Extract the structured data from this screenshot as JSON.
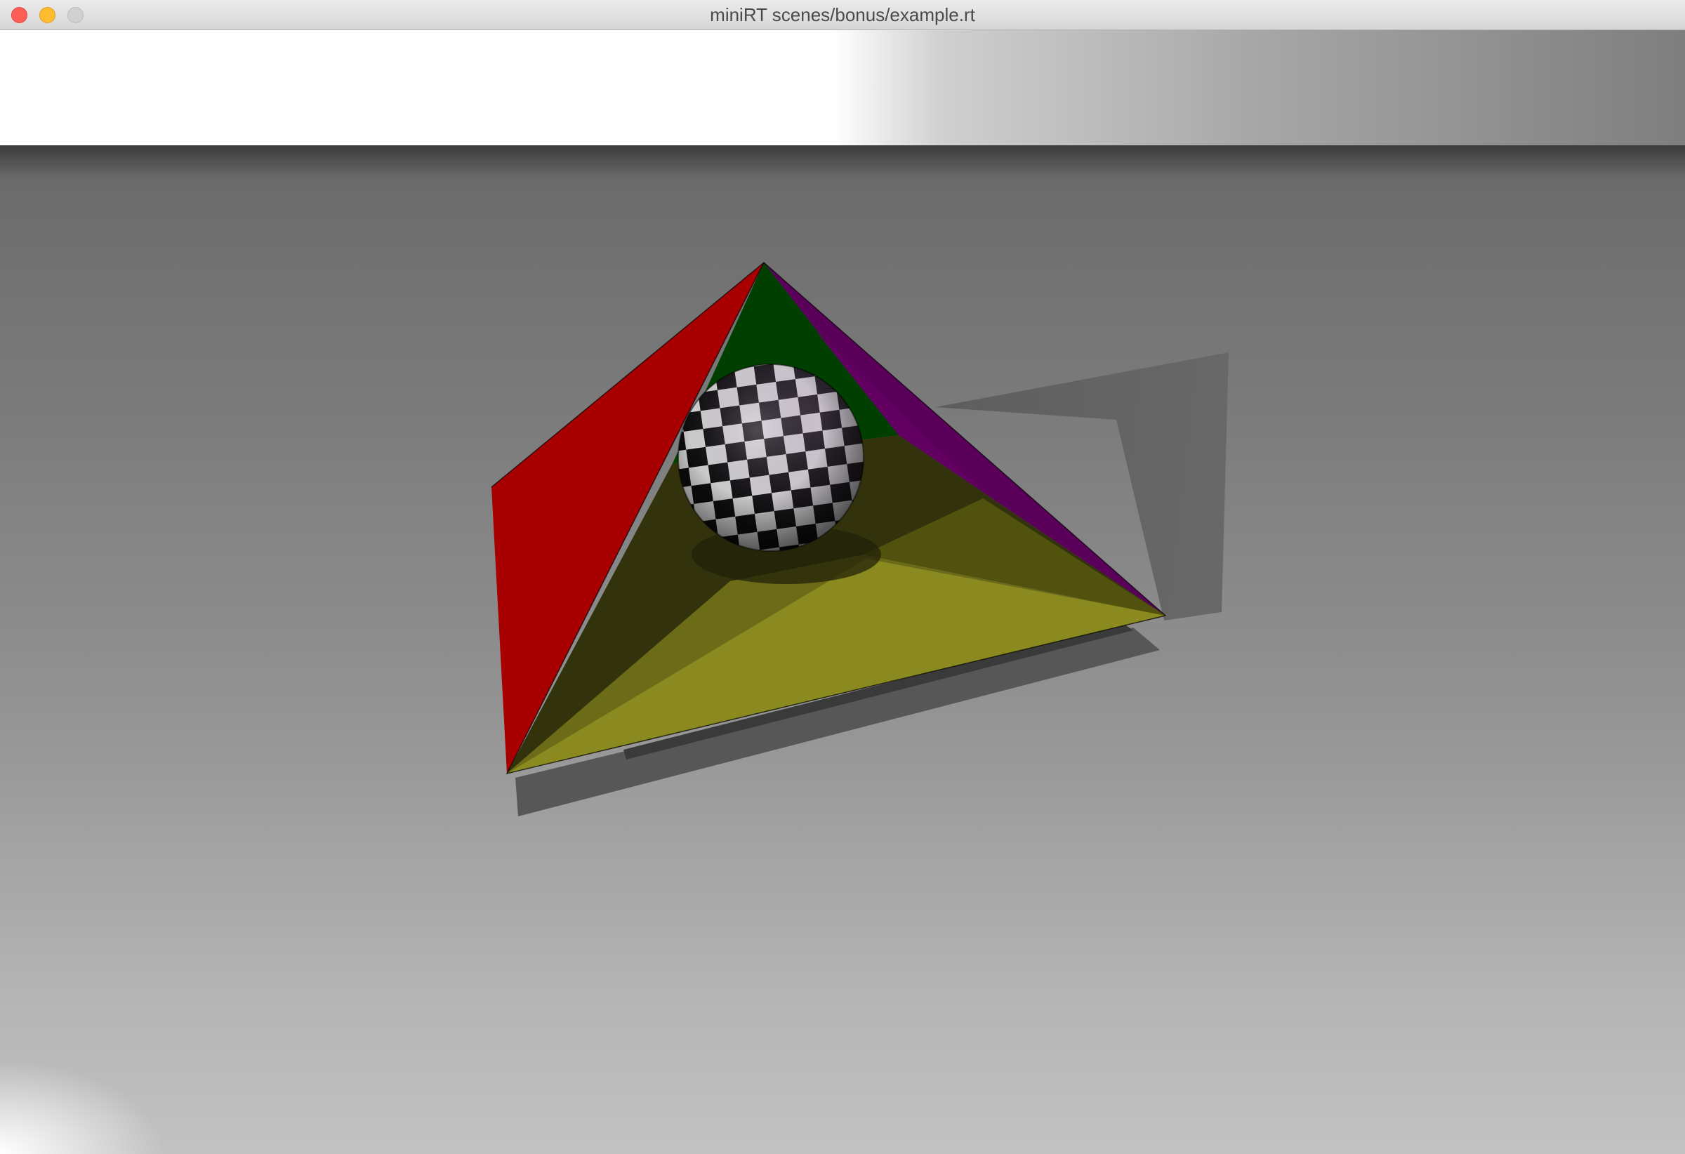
{
  "window": {
    "title": "miniRT scenes/bonus/example.rt"
  },
  "controls": {
    "close_icon": "close-icon",
    "minimize_icon": "minimize-icon",
    "zoom_icon": "zoom-icon"
  },
  "scene": {
    "faces": [
      {
        "name": "red-face",
        "color": "#a80000"
      },
      {
        "name": "green-face",
        "color": "#003f00"
      },
      {
        "name": "purple-face",
        "color": "#5a005a"
      },
      {
        "name": "yellow-face",
        "color": "#8a8a20"
      }
    ],
    "sphere": {
      "pattern": "checkerboard",
      "colors": [
        "#0a0a0a",
        "#dcdcdc"
      ]
    },
    "floor_color": "#8a8a8a"
  }
}
